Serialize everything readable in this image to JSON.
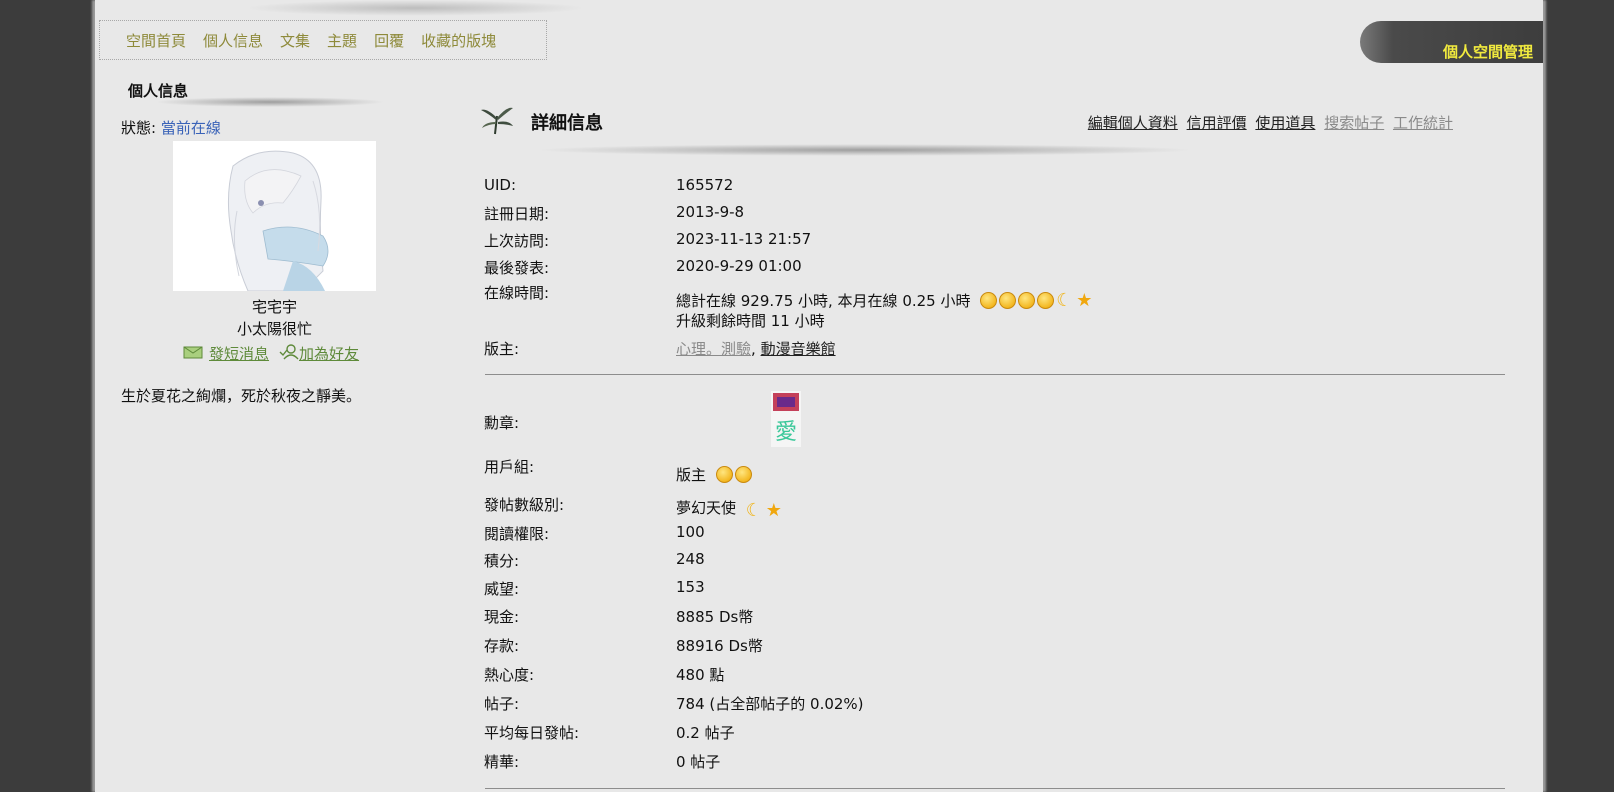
{
  "nav": {
    "items": [
      "空間首頁",
      "個人信息",
      "文集",
      "主題",
      "回覆",
      "收藏的版塊"
    ],
    "manage": "個人空間管理"
  },
  "profile": {
    "section_title": "個人信息",
    "status_label": "狀態:",
    "status_value": "當前在線",
    "name": "宅宅宇",
    "subtitle": "小太陽很忙",
    "send_message": "發短消息",
    "add_friend": "加為好友",
    "motto": "生於夏花之絢爛，死於秋夜之靜美。"
  },
  "details": {
    "title": "詳細信息",
    "links": [
      "編輯個人資料",
      "信用評價",
      "使用道具",
      "搜索帖子",
      "工作統計"
    ],
    "uid_label": "UID:",
    "uid": "165572",
    "reg_label": "註冊日期:",
    "reg": "2013-9-8",
    "last_visit_label": "上次訪問:",
    "last_visit": "2023-11-13 21:57",
    "last_post_label": "最後發表:",
    "last_post": "2020-9-29 01:00",
    "online_label": "在線時間:",
    "online": "總計在線 929.75 小時, 本月在線 0.25 小時",
    "upgrade": "升級剩餘時間 11 小時",
    "moderator_label": "版主:",
    "forums": [
      "心理。測驗",
      "動漫音樂館"
    ],
    "medal_label": "勳章:",
    "group_label": "用戶組:",
    "group": "版主",
    "post_level_label": "發帖數級別:",
    "post_level": "夢幻天使",
    "read_label": "閱讀權限:",
    "read": "100",
    "score_label": "積分:",
    "score": "248",
    "prestige_label": "威望:",
    "prestige": "153",
    "cash_label": "現金:",
    "cash": "8885 Ds幣",
    "deposit_label": "存款:",
    "deposit": "88916 Ds幣",
    "enthusiasm_label": "熱心度:",
    "enthusiasm": "480 點",
    "posts_label": "帖子:",
    "posts": "784 (占全部帖子的 0.02%)",
    "daily_label": "平均每日發帖:",
    "daily": "0.2 帖子",
    "digest_label": "精華:",
    "digest": "0 帖子"
  }
}
